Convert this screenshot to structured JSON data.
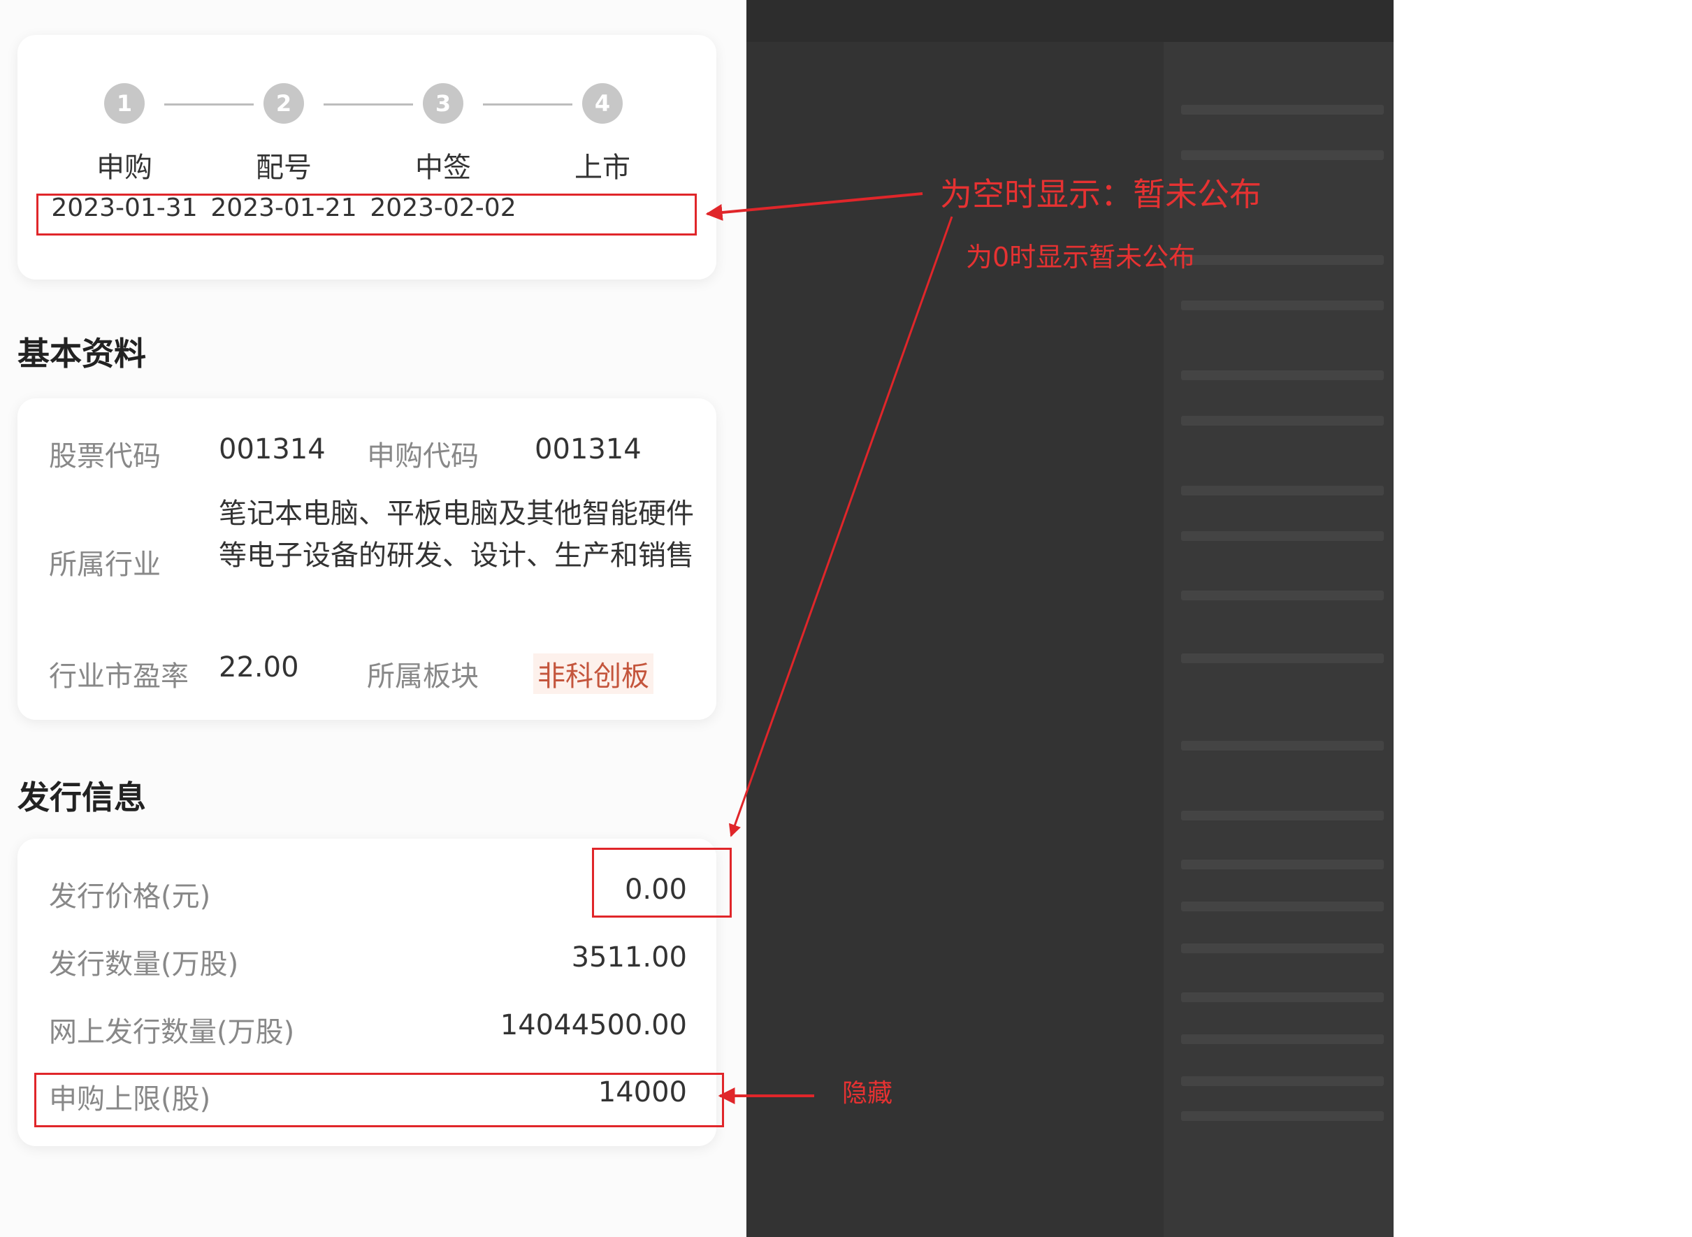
{
  "steps": [
    {
      "num": "1",
      "name": "申购",
      "date": "2023-01-31"
    },
    {
      "num": "2",
      "name": "配号",
      "date": "2023-01-21"
    },
    {
      "num": "3",
      "name": "中签",
      "date": "2023-02-02"
    },
    {
      "num": "4",
      "name": "上市",
      "date": ""
    }
  ],
  "basic": {
    "title": "基本资料",
    "stock_code_label": "股票代码",
    "stock_code": "001314",
    "subscribe_code_label": "申购代码",
    "subscribe_code": "001314",
    "industry_label": "所属行业",
    "industry": "笔记本电脑、平板电脑及其他智能硬件等电子设备的研发、设计、生产和销售",
    "pe_label": "行业市盈率",
    "pe": "22.00",
    "board_label": "所属板块",
    "board": "非科创板"
  },
  "issue": {
    "title": "发行信息",
    "rows": [
      {
        "label": "发行价格(元)",
        "value": "0.00"
      },
      {
        "label": "发行数量(万股)",
        "value": "3511.00"
      },
      {
        "label": "网上发行数量(万股)",
        "value": "14044500.00"
      },
      {
        "label": "申购上限(股)",
        "value": "14000"
      }
    ]
  },
  "annotations": {
    "empty_note": "为空时显示：暂未公布",
    "zero_note": "为0时显示暂未公布",
    "hide_note": "隐藏",
    "color": "#e63232"
  }
}
